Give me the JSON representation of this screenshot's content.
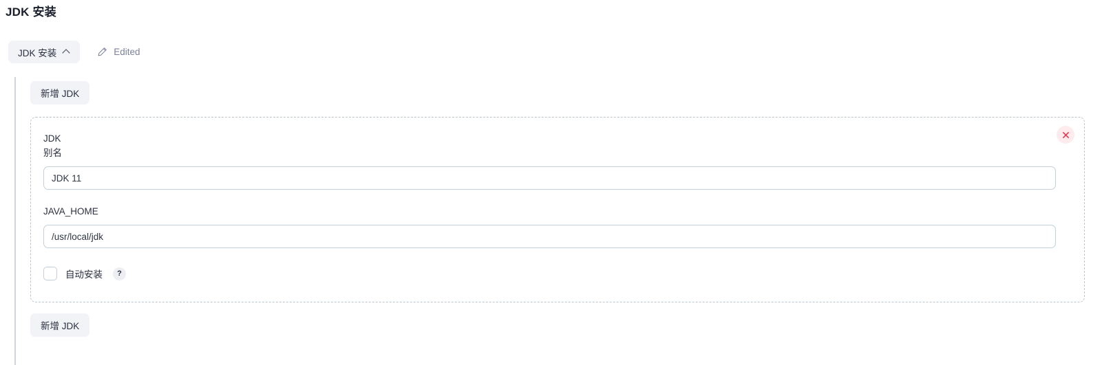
{
  "page": {
    "title": "JDK 安装"
  },
  "section": {
    "collapse_label": "JDK 安装",
    "collapse_icon": "chevron-up-icon",
    "edit_icon": "pencil-icon",
    "edited_label": "Edited"
  },
  "actions": {
    "add_jdk_top": "新增 JDK",
    "add_jdk_bottom": "新增 JDK"
  },
  "jdk_card": {
    "remove_icon": "close-x-icon",
    "alias": {
      "label": "JDK\n别名",
      "value": "JDK 11",
      "placeholder": ""
    },
    "java_home": {
      "label": "JAVA_HOME",
      "value": "/usr/local/jdk",
      "placeholder": ""
    },
    "auto_install": {
      "label": "自动安装",
      "checked": false,
      "help_icon": "question-mark-icon",
      "help_label": "?"
    }
  },
  "colors": {
    "accent_danger": "#e8374a",
    "danger_bg": "#fdebee",
    "pill_bg": "#f1f3f7",
    "input_border": "#c4d0d8",
    "dashed_border": "#b9c4cc",
    "rail": "#ccd5db",
    "muted_text": "#7b819a"
  }
}
